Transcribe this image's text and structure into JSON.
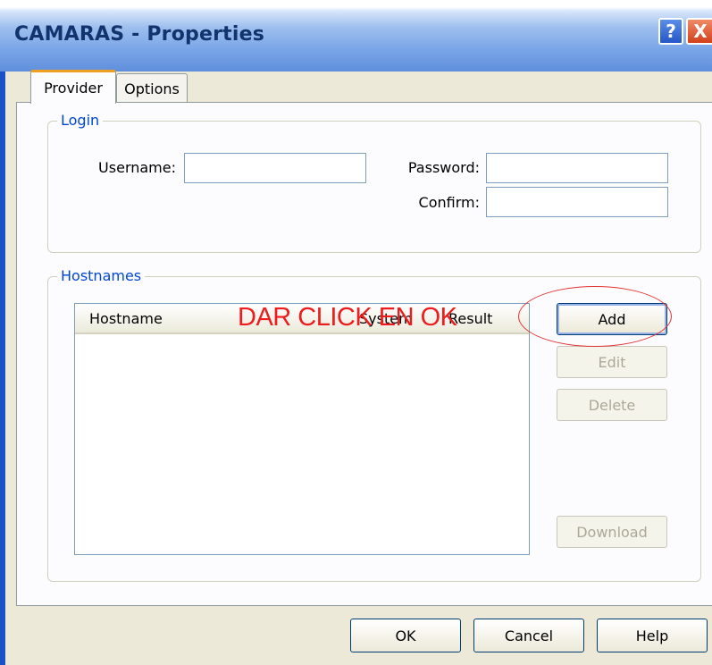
{
  "window": {
    "title": "CAMARAS - Properties"
  },
  "titlebar": {
    "help_glyph": "?",
    "close_glyph": "X"
  },
  "tabs": [
    {
      "label": "Provider"
    },
    {
      "label": "Options"
    }
  ],
  "login": {
    "legend": "Login",
    "username_label": "Username:",
    "username_value": "",
    "password_label": "Password:",
    "password_value": "",
    "confirm_label": "Confirm:",
    "confirm_value": ""
  },
  "hostnames": {
    "legend": "Hostnames",
    "columns": [
      "Hostname",
      "System",
      "Result"
    ],
    "rows": [],
    "buttons": {
      "add": "Add",
      "edit": "Edit",
      "delete": "Delete",
      "download": "Download"
    }
  },
  "annotation": {
    "text": "DAR CLICK EN OK",
    "color": "#ee1c1c"
  },
  "footer": {
    "ok": "OK",
    "cancel": "Cancel",
    "help": "Help"
  },
  "colors": {
    "accent": "#0046d5",
    "tab_highlight": "#f0a020",
    "titlebar": "#5f8fdc"
  }
}
